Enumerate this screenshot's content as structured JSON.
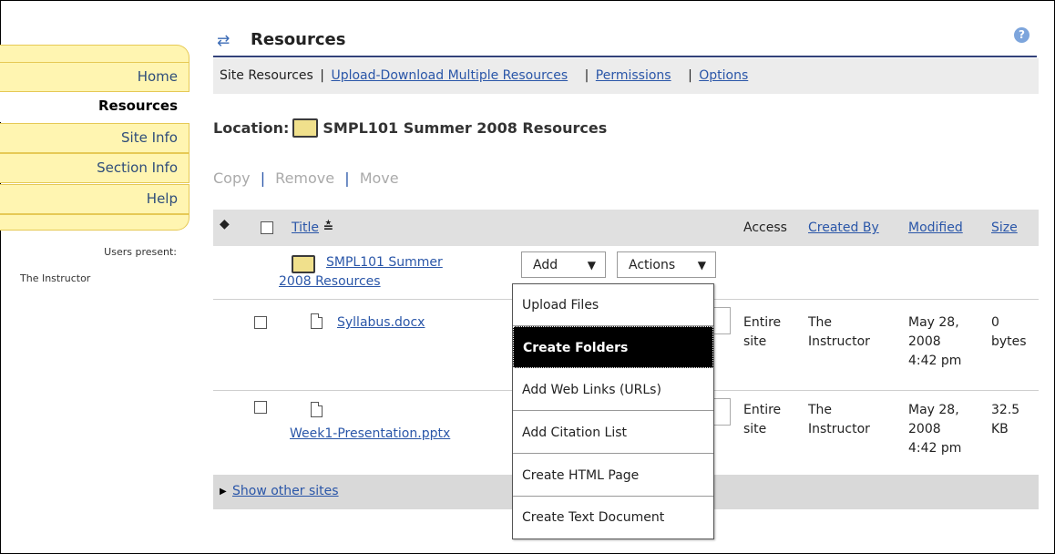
{
  "nav": {
    "items": [
      {
        "label": "Home"
      },
      {
        "label": "Resources"
      },
      {
        "label": "Site Info"
      },
      {
        "label": "Section Info"
      },
      {
        "label": "Help"
      }
    ],
    "presence_label": "Users present:",
    "presence_user": "The Instructor"
  },
  "header": {
    "title": "Resources",
    "help_glyph": "?"
  },
  "menubar": {
    "site_resources": "Site Resources",
    "upload_download": "Upload-Download Multiple Resources",
    "permissions": "Permissions",
    "options": "Options",
    "separator": "|"
  },
  "location": {
    "label": "Location:",
    "name": "SMPL101 Summer 2008 Resources"
  },
  "bulk_actions": {
    "copy": "Copy",
    "remove": "Remove",
    "move": "Move",
    "separator": "|"
  },
  "table": {
    "headers": {
      "title": "Title",
      "sort_glyph": "≛",
      "access": "Access",
      "created_by": "Created By",
      "modified": "Modified",
      "size": "Size"
    },
    "folder_row": {
      "title_line1": "SMPL101 Summer",
      "title_line2": "2008 Resources",
      "add_label": "Add",
      "actions_label": "Actions"
    },
    "rows": [
      {
        "title": "Syllabus.docx",
        "access_line1": "Entire",
        "access_line2": "site",
        "created_line1": "The",
        "created_line2": "Instructor",
        "modified_line1": "May 28,",
        "modified_line2": "2008",
        "modified_line3": "4:42 pm",
        "size_line1": "0",
        "size_line2": "bytes"
      },
      {
        "title": "Week1-Presentation.pptx",
        "access_line1": "Entire",
        "access_line2": "site",
        "created_line1": "The",
        "created_line2": "Instructor",
        "modified_line1": "May 28,",
        "modified_line2": "2008",
        "modified_line3": "4:42 pm",
        "size_line1": "32.5",
        "size_line2": "KB"
      }
    ]
  },
  "footer": {
    "show_other_sites": "Show other sites"
  },
  "add_menu": {
    "items": [
      {
        "label": "Upload Files"
      },
      {
        "label": "Create Folders",
        "selected": true
      },
      {
        "label": "Add Web Links (URLs)"
      },
      {
        "label": "Add Citation List"
      },
      {
        "label": "Create HTML Page"
      },
      {
        "label": "Create Text Document"
      }
    ]
  },
  "colors": {
    "nav_bg": "#fff5b1",
    "nav_border": "#e6c955",
    "link": "#2a56a8",
    "header_rule": "#33427a"
  }
}
